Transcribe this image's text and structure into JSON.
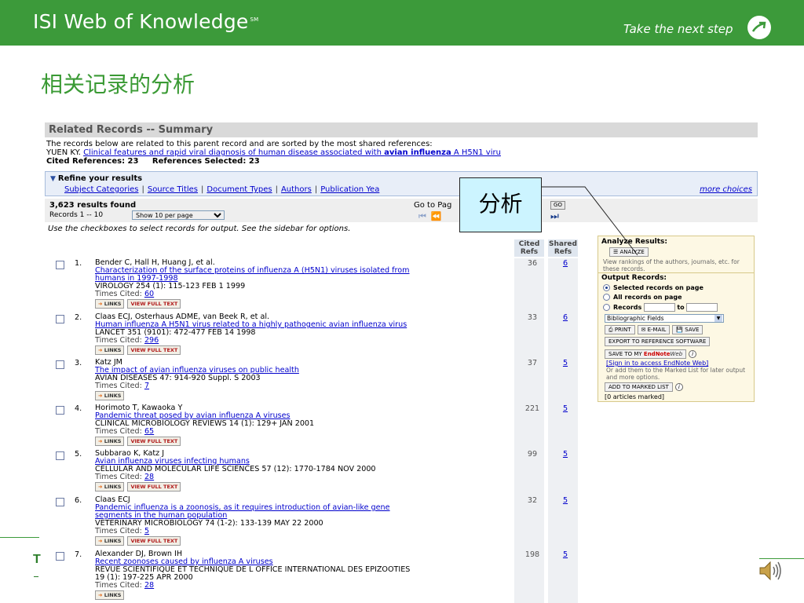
{
  "slide": {
    "brand": "ISI Web of Knowledge",
    "brand_tm": "SM",
    "tagline": "Take the next step",
    "title": "相关记录的分析",
    "footer_fragment": "T"
  },
  "callout": {
    "text": "分析"
  },
  "wos": {
    "header": "Related Records -- Summary",
    "intro_text": "The records below are related to this parent record and are sorted by the most shared references:",
    "parent_author": "YUEN KY.",
    "parent_title_start": "Clinical features and rapid viral diagnosis of human disease associated with ",
    "parent_title_bold": "avian influenza",
    "parent_title_end": " A H5N1 viru",
    "cited_refs_label": "Cited References: 23",
    "refs_selected_label": "References Selected: 23",
    "refine": {
      "title": "Refine your results",
      "links": [
        "Subject Categories",
        "Source Titles",
        "Document Types",
        "Authors",
        "Publication Yea"
      ],
      "more": "more choices"
    },
    "results": {
      "count": "3,623 results found",
      "range": "Records 1 -- 10",
      "per_page": "Show 10 per page",
      "goto_label": "Go to Pag",
      "go": "GO"
    },
    "usecheck": "Use the checkboxes to select records for output. See the sidebar for options.",
    "columns": {
      "cited": "Cited\nRefs",
      "shared": "Shared\nRefs"
    },
    "records": [
      {
        "num": "1.",
        "authors": "Bender C, Hall H, Huang J, et al.",
        "title_lines": [
          "Characterization of the surface proteins of influenza A (H5N1) viruses isolated from",
          "humans in 1997-1998"
        ],
        "source_lines": [
          "VIROLOGY 254 (1): 115-123 FEB 1 1999"
        ],
        "times_cited": "60",
        "has_vft": true,
        "cited_refs": "36",
        "shared_refs": "6"
      },
      {
        "num": "2.",
        "authors": "Claas ECJ, Osterhaus ADME, van Beek R, et al.",
        "title_lines": [
          "Human influenza A H5N1 virus related to a highly pathogenic avian influenza virus"
        ],
        "source_lines": [
          "LANCET 351 (9101): 472-477 FEB 14 1998"
        ],
        "times_cited": "296",
        "has_vft": true,
        "cited_refs": "33",
        "shared_refs": "6"
      },
      {
        "num": "3.",
        "authors": "Katz JM",
        "title_lines": [
          "The impact of avian influenza viruses on public health"
        ],
        "source_lines": [
          "AVIAN DISEASES 47: 914-920 Suppl. S 2003"
        ],
        "times_cited": "7",
        "has_vft": false,
        "cited_refs": "37",
        "shared_refs": "5"
      },
      {
        "num": "4.",
        "authors": "Horimoto T, Kawaoka Y",
        "title_lines": [
          "Pandemic threat posed by avian influenza A viruses"
        ],
        "source_lines": [
          "CLINICAL MICROBIOLOGY REVIEWS 14 (1): 129+ JAN 2001"
        ],
        "times_cited": "65",
        "has_vft": true,
        "cited_refs": "221",
        "shared_refs": "5"
      },
      {
        "num": "5.",
        "authors": "Subbarao K, Katz J",
        "title_lines": [
          "Avian influenza viruses infecting humans"
        ],
        "source_lines": [
          "CELLULAR AND MOLECULAR LIFE SCIENCES 57 (12): 1770-1784 NOV 2000"
        ],
        "times_cited": "28",
        "has_vft": true,
        "cited_refs": "99",
        "shared_refs": "5"
      },
      {
        "num": "6.",
        "authors": "Claas ECJ",
        "title_lines": [
          "Pandemic influenza is a zoonosis, as it requires introduction of avian-like gene",
          "segments in the human population"
        ],
        "source_lines": [
          "VETERINARY MICROBIOLOGY 74 (1-2): 133-139 MAY 22 2000"
        ],
        "times_cited": "5",
        "has_vft": true,
        "cited_refs": "32",
        "shared_refs": "5"
      },
      {
        "num": "7.",
        "authors": "Alexander DJ, Brown IH",
        "title_lines": [
          "Recent zoonoses caused by influenza A viruses"
        ],
        "source_lines": [
          "REVUE SCIENTIFIQUE ET TECHNIQUE DE L OFFICE INTERNATIONAL DES EPIZOOTIES",
          "19 (1): 197-225 APR 2000"
        ],
        "times_cited": "28",
        "has_vft": false,
        "cited_refs": "198",
        "shared_refs": "5"
      }
    ],
    "labels": {
      "times_cited": "Times Cited: ",
      "links": "LINKS",
      "vft": "VIEW FULL TEXT"
    },
    "panel": {
      "analyze_title": "Analyze Results:",
      "analyze_btn": "ANALYZE",
      "analyze_sub": "View rankings of the authors, journals, etc. for these records.",
      "output_title": "Output Records:",
      "opt_selected": "Selected records on page",
      "opt_all": "All records on page",
      "opt_records": "Records",
      "to": "to",
      "fields_select": "Bibliographic Fields",
      "print": "PRINT",
      "email": "E-MAIL",
      "save": "SAVE",
      "export": "EXPORT TO REFERENCE SOFTWARE",
      "save_to_my": "SAVE TO MY",
      "endnote": "EndNote",
      "web": "Web",
      "sign_in": "[Sign in to access EndNote Web]",
      "marked_sub": "Or add them to the Marked List for later output and more options.",
      "add_marked": "ADD TO MARKED LIST",
      "marked_count": "[0 articles marked]"
    }
  },
  "colors": {
    "brand_green": "#3c9a3a",
    "title_green": "#3a9a34",
    "link": "#0000cc",
    "callout_bg": "#ccf4ff"
  }
}
